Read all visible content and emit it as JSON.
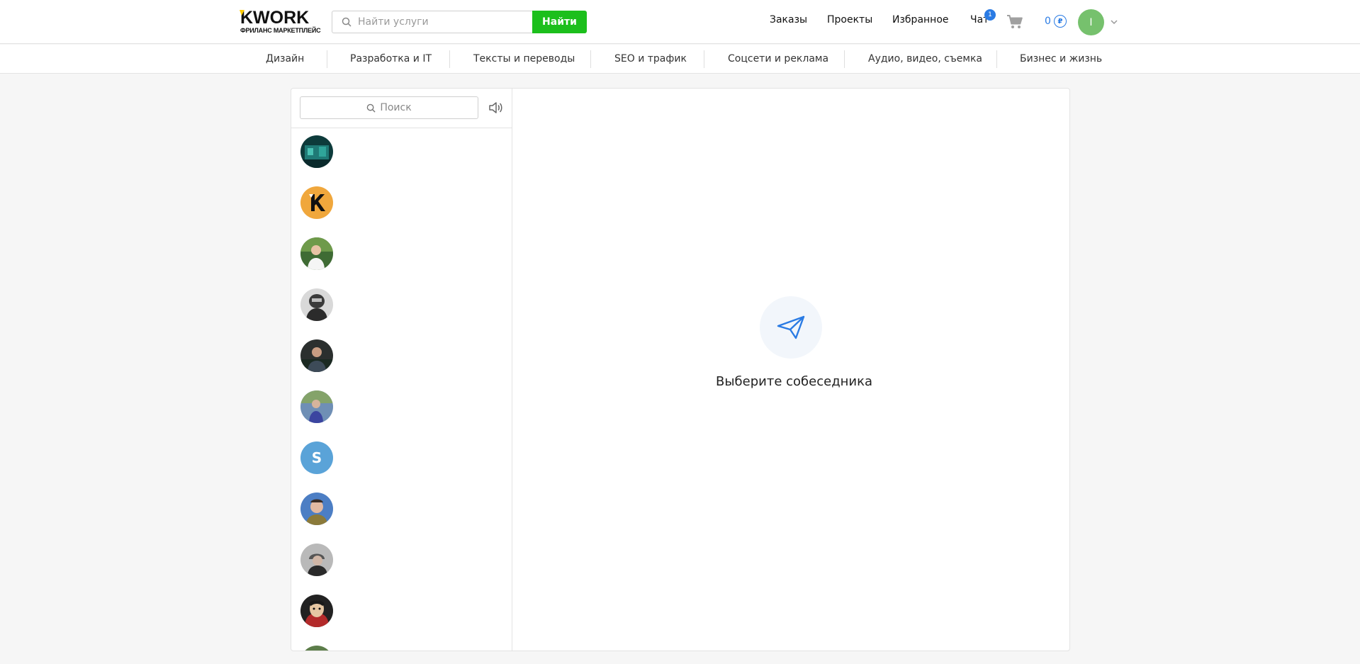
{
  "header": {
    "logo_text": "KWORK",
    "logo_subtitle": "ФРИЛАНС МАРКЕТПЛЕЙС",
    "search_placeholder": "Найти услуги",
    "search_button": "Найти",
    "nav": [
      "Заказы",
      "Проекты",
      "Избранное",
      "Чат"
    ],
    "chat_badge": "1",
    "balance": "0",
    "currency_symbol": "₽",
    "user_initial": "I"
  },
  "categories": [
    "Дизайн",
    "Разработка и IT",
    "Тексты и переводы",
    "SEO и трафик",
    "Соцсети и реклама",
    "Аудио, видео, съемка",
    "Бизнес и жизнь"
  ],
  "chat": {
    "search_placeholder": "Поиск",
    "contact_letter": "S",
    "empty_state": "Выберите собеседника"
  },
  "colors": {
    "accent_green": "#1cbf1c",
    "accent_blue": "#2a7be4",
    "avatar_green": "#76c16d"
  }
}
